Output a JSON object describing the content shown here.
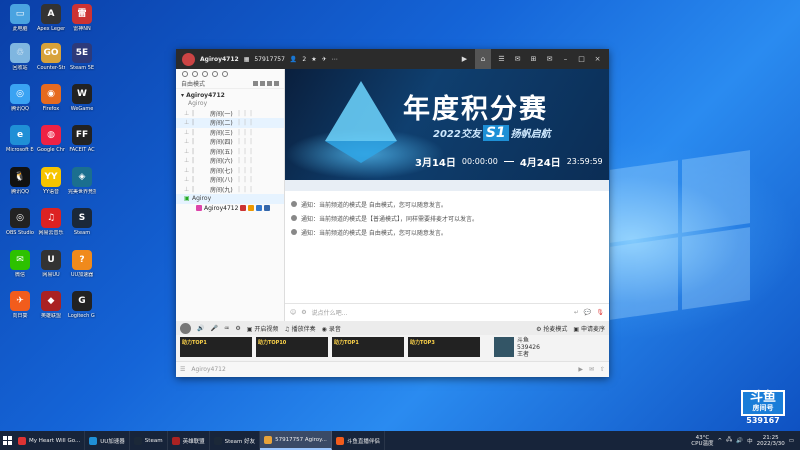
{
  "desktop": {
    "icons": [
      {
        "label": "此电脑",
        "color": "#4aa3e0",
        "glyph": "▭"
      },
      {
        "label": "Apex Legends",
        "color": "#333",
        "glyph": "A"
      },
      {
        "label": "雷神NN",
        "color": "#c33",
        "glyph": "雷"
      },
      {
        "label": "回收站",
        "color": "#7fb6e0",
        "glyph": "♲"
      },
      {
        "label": "Counter-Strike Global",
        "color": "#d8a23a",
        "glyph": "GO"
      },
      {
        "label": "Steam 5E",
        "color": "#2d3a7a",
        "glyph": "5E"
      },
      {
        "label": "腾讯QQ",
        "color": "#3aa3f3",
        "glyph": "◎"
      },
      {
        "label": "Firefox",
        "color": "#e66a1f",
        "glyph": "◉"
      },
      {
        "label": "WeGame",
        "color": "#222",
        "glyph": "W"
      },
      {
        "label": "Microsoft Edge",
        "color": "#1f8fd6",
        "glyph": "e"
      },
      {
        "label": "Google Chrome",
        "color": "#e24",
        "glyph": "◍"
      },
      {
        "label": "FACEIT AC",
        "color": "#222",
        "glyph": "FF"
      },
      {
        "label": "腾讯QQ",
        "color": "#111",
        "glyph": "🐧"
      },
      {
        "label": "YY语音",
        "color": "#f6c400",
        "glyph": "YY"
      },
      {
        "label": "完美世界竞技平台",
        "color": "#1b6f8f",
        "glyph": "◈"
      },
      {
        "label": "OBS Studio",
        "color": "#222",
        "glyph": "◎"
      },
      {
        "label": "网易云音乐",
        "color": "#d22",
        "glyph": "♫"
      },
      {
        "label": "Steam",
        "color": "#1b2838",
        "glyph": "S"
      },
      {
        "label": "微信",
        "color": "#2dc100",
        "glyph": "✉"
      },
      {
        "label": "网易UU",
        "color": "#333",
        "glyph": "U"
      },
      {
        "label": "UU加速器",
        "color": "#f08a1c",
        "glyph": "?"
      },
      {
        "label": "向日葵",
        "color": "#f25c1c",
        "glyph": "✈"
      },
      {
        "label": "英雄联盟",
        "color": "#a22",
        "glyph": "◆"
      },
      {
        "label": "Logitech G HUB",
        "color": "#222",
        "glyph": "G"
      }
    ]
  },
  "window": {
    "title": {
      "username": "Agiroy4712",
      "room_id": "57917757",
      "online": "2",
      "icons": [
        "star-icon",
        "plane-icon",
        "more-icon"
      ]
    },
    "left_pane": {
      "mode": "自由模式",
      "room_name": "Agiroy4712",
      "group_label": "Agiroy",
      "channels": [
        "房间(一)",
        "房间(二)",
        "房间(三)",
        "房间(四)",
        "房间(五)",
        "房间(六)",
        "房间(七)",
        "房间(八)",
        "房间(九)"
      ],
      "current_channel": "Agiroy",
      "member": "Agiroy4712"
    },
    "banner": {
      "title": "年度积分赛",
      "sub_prefix": "2022交友",
      "sub_badge": "S1",
      "sub_suffix": "扬帆启航",
      "start_date": "3月14日",
      "start_time": "00:00:00",
      "end_date": "4月24日",
      "end_time": "23:59:59"
    },
    "chat": {
      "notices": [
        "通知：当前频道的模式是 自由模式，您可以随意发言。",
        "通知：当前频道的模式是【普通模式】，同样需要排麦才可以发言。",
        "通知：当前频道的模式是 自由模式，您可以随意发言。"
      ],
      "input_placeholder": "说点什么吧..."
    },
    "controls": {
      "open_video": "开启视频",
      "play_music": "播放伴奏",
      "recording": "录音",
      "mode_status": "抢麦模式",
      "apply_mic": "申请麦序"
    },
    "thumbs": [
      {
        "label": "助力TOP1"
      },
      {
        "label": "助力TOP10"
      },
      {
        "label": "助力TOP1"
      },
      {
        "label": "助力TOP3"
      }
    ],
    "hot": {
      "name": "斗鱼",
      "views": "539426",
      "tag": "王者"
    },
    "status": {
      "user": "Agiroy4712"
    }
  },
  "taskbar": {
    "tasks": [
      {
        "label": "My Heart Will Go...",
        "color": "#d33",
        "active": false
      },
      {
        "label": "UU加速器",
        "color": "#1f8fd6",
        "active": false
      },
      {
        "label": "Steam",
        "color": "#1b2838",
        "active": false
      },
      {
        "label": "英雄联盟",
        "color": "#a22",
        "active": false
      },
      {
        "label": "Steam 好友",
        "color": "#1b2838",
        "active": false
      },
      {
        "label": "57917757 Agiroy...",
        "color": "#e8a33a",
        "active": true
      },
      {
        "label": "斗鱼直播伴侣",
        "color": "#f25c1c",
        "active": false
      }
    ],
    "weather_temp": "43°C",
    "weather_desc": "CPU温度",
    "time": "21:25",
    "date": "2022/3/30"
  },
  "watermark": {
    "logo_top": "斗鱼",
    "logo_bottom": "房间号",
    "room": "539167"
  }
}
